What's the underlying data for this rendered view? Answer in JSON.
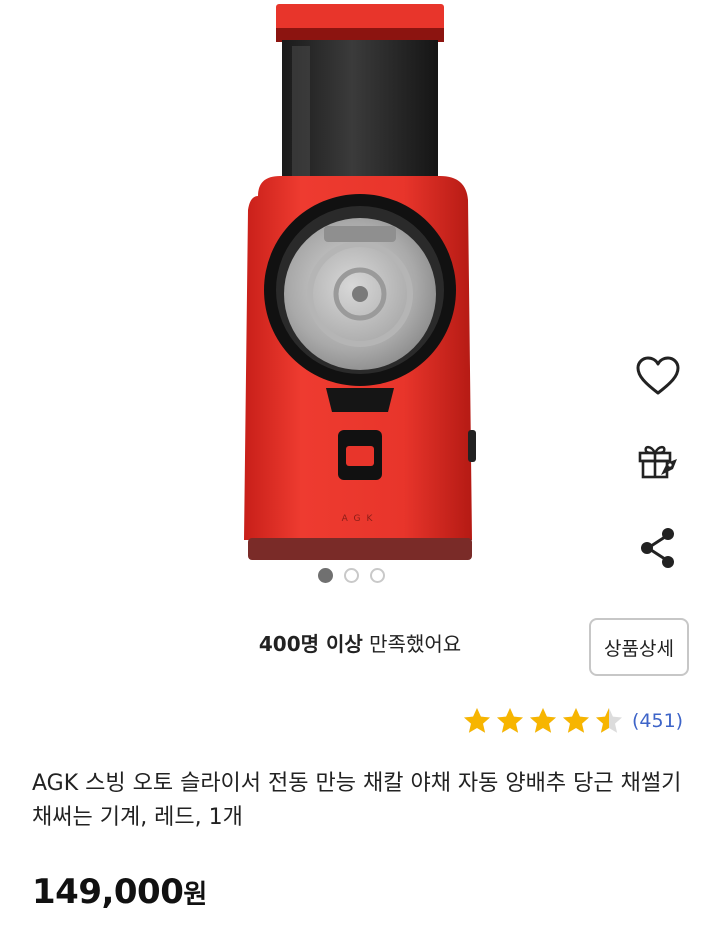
{
  "product": {
    "brand_mark": "AGK",
    "title": "AGK 스빙 오토 슬라이서 전동 만능 채칼 야채 자동 양배추 당근 채썰기 채써는 기계, 레드, 1개",
    "price_number": "149,000",
    "price_unit": "원",
    "color": "#e8352b"
  },
  "carousel": {
    "total": 3,
    "active": 1
  },
  "actions": {
    "wishlist_icon": "heart-icon",
    "gift_icon": "gift-icon",
    "share_icon": "share-icon"
  },
  "satisfaction": {
    "count_text": "400명 이상",
    "rest_text": " 만족했어요"
  },
  "detail_button": {
    "label": "상품상세"
  },
  "rating": {
    "stars": 4.5,
    "max": 5,
    "review_count": "(451)",
    "star_color": "#f7b500"
  }
}
